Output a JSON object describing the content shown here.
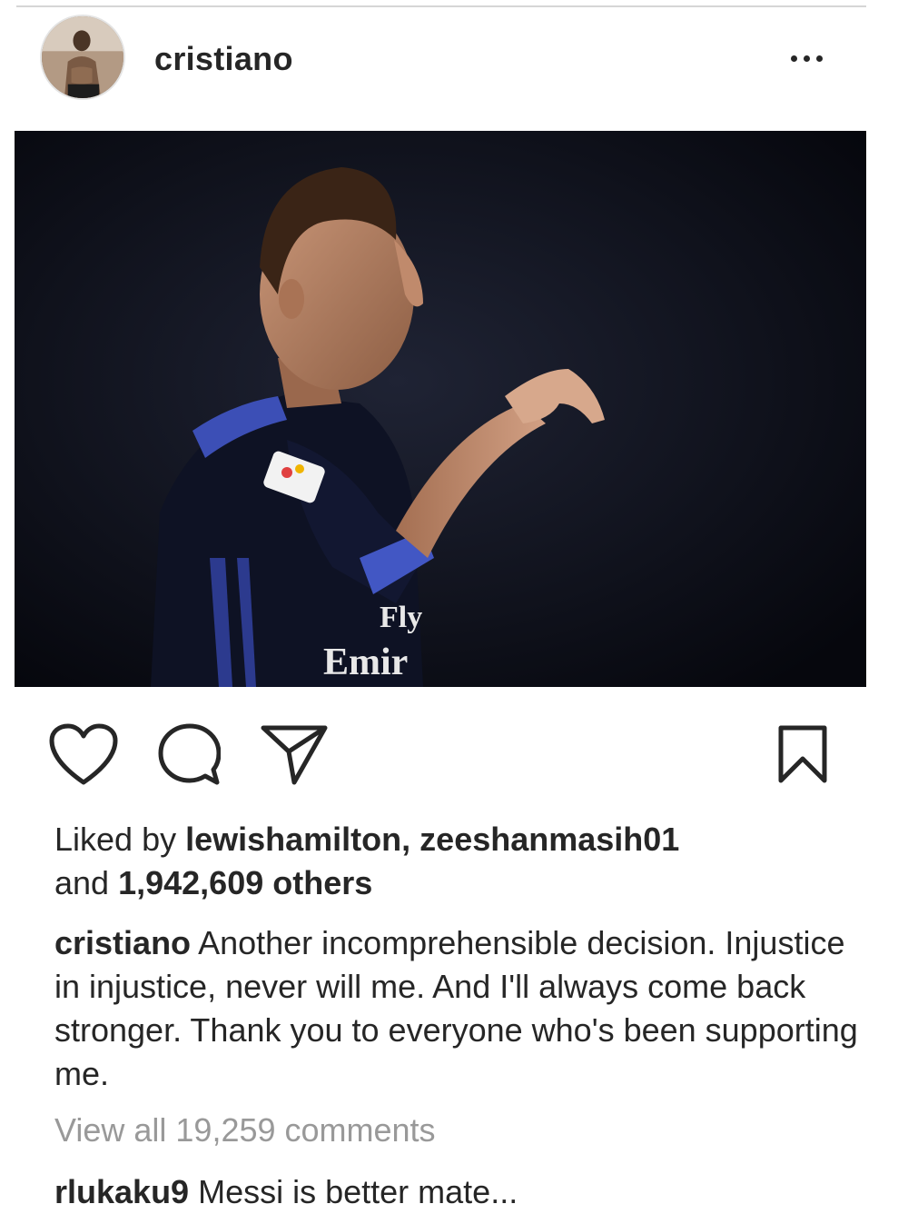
{
  "post": {
    "username": "cristiano",
    "photo_jersey_text": "Emir",
    "photo_jersey_text_top": "Fly"
  },
  "likes": {
    "prefix": "Liked by",
    "user1": "lewishamilton,",
    "user2": "zeeshanmasih01",
    "joiner": "and",
    "count": "1,942,609 others"
  },
  "caption": {
    "username": "cristiano",
    "text": "Another incomprehensible decision. Injustice in injustice, never will me. And I'll always come back stronger. Thank you to everyone who's been supporting me."
  },
  "comments": {
    "view_all": "View all 19,259 comments",
    "first": {
      "username": "rlukaku9",
      "text": "Messi is better mate..."
    }
  },
  "icons": {
    "like": "heart-icon",
    "comment": "comment-bubble-icon",
    "share": "paper-plane-icon",
    "save": "bookmark-icon",
    "more": "more-options-icon"
  },
  "colors": {
    "text": "#262626",
    "muted": "#999999",
    "divider": "#d6d6d6"
  }
}
